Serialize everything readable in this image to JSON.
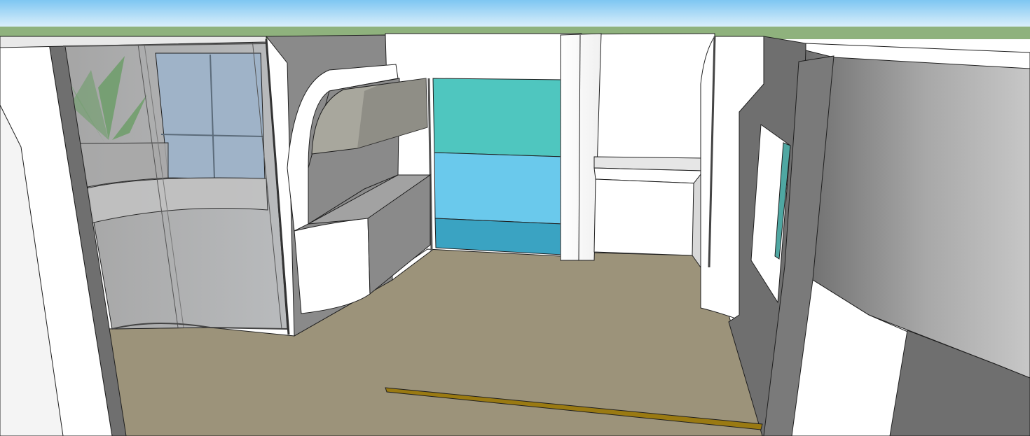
{
  "scene": {
    "view": "3d-model-perspective",
    "subject": "interior-room-model",
    "colors": {
      "sky_top": "#7ec6f2",
      "sky_bottom": "#dff1fb",
      "ground": "#8fb27d",
      "floor": "#9c937a",
      "wall_white": "#ffffff",
      "wall_gray": "#8a8a8a",
      "wall_dark": "#6f6f6f",
      "glass": "#b9c4cc",
      "window_blue": "#9fb3c8",
      "aqua_top": "#4fc6bf",
      "aqua_mid": "#6ac9ec",
      "aqua_bottom": "#3aa3c2",
      "stone": "#a8a79d",
      "plant": "#6e9e6a",
      "floor_strip": "#9a7a12",
      "edge": "#1f1f1f"
    }
  }
}
